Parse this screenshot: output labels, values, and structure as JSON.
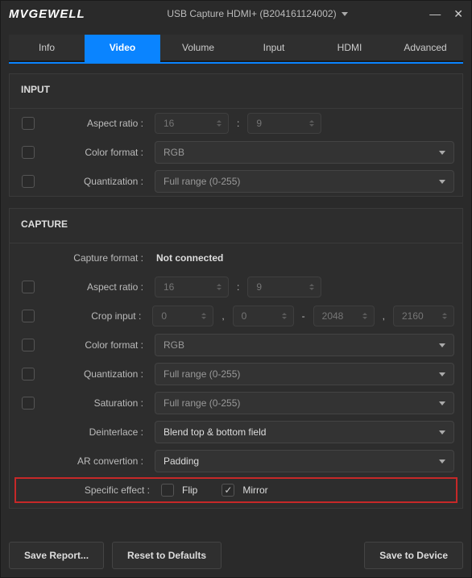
{
  "titlebar": {
    "logo": "MVGEWELL",
    "device": "USB Capture HDMI+ (B204161124002)"
  },
  "tabs": [
    "Info",
    "Video",
    "Volume",
    "Input",
    "HDMI",
    "Advanced"
  ],
  "input_section": {
    "title": "INPUT",
    "aspect_label": "Aspect ratio :",
    "aspect_w": "16",
    "aspect_sep": ":",
    "aspect_h": "9",
    "colorfmt_label": "Color format :",
    "colorfmt_val": "RGB",
    "quant_label": "Quantization :",
    "quant_val": "Full range (0-255)"
  },
  "capture_section": {
    "title": "CAPTURE",
    "capfmt_label": "Capture format :",
    "capfmt_val": "Not connected",
    "aspect_label": "Aspect ratio :",
    "aspect_w": "16",
    "aspect_sep": ":",
    "aspect_h": "9",
    "crop_label": "Crop input :",
    "crop_x": "0",
    "crop_y": "0",
    "crop_w": "2048",
    "crop_h": "2160",
    "comma": ",",
    "dash": "-",
    "colorfmt_label": "Color format :",
    "colorfmt_val": "RGB",
    "quant_label": "Quantization :",
    "quant_val": "Full range (0-255)",
    "sat_label": "Saturation :",
    "sat_val": "Full range (0-255)",
    "deint_label": "Deinterlace :",
    "deint_val": "Blend top & bottom field",
    "ar_label": "AR convertion :",
    "ar_val": "Padding",
    "fx_label": "Specific effect :",
    "flip": "Flip",
    "mirror": "Mirror"
  },
  "footer": {
    "save_report": "Save Report...",
    "reset": "Reset to Defaults",
    "save_device": "Save to Device"
  }
}
